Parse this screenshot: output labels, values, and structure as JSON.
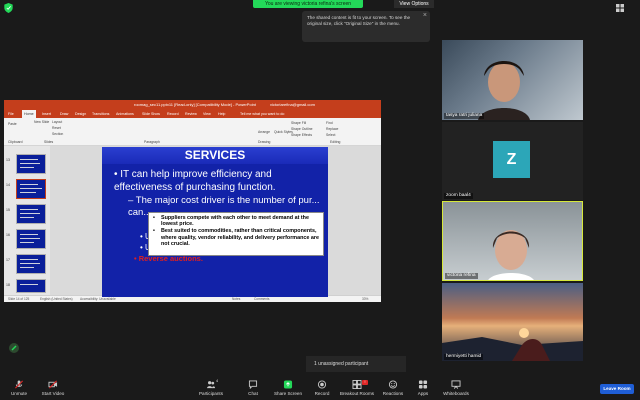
{
  "banner": {
    "sharing_text": "You are viewing victoria refina's screen",
    "view_options": "View Options"
  },
  "toast": {
    "text": "The shared content is fit to your screen. To see the original size, click \"Original Size\" in the menu."
  },
  "ppt": {
    "title": "roomag_sec11.pptx11 [Read-only] [Compatibility Mode] - PowerPoint",
    "account": "victoriarefina@gmail.com",
    "menu": [
      "File",
      "Home",
      "Insert",
      "Draw",
      "Design",
      "Transitions",
      "Animations",
      "Slide Show",
      "Record",
      "Review",
      "View",
      "Help",
      "Tell me what you want to do"
    ],
    "ribbon": {
      "paste": "Paste",
      "layout": "Layout",
      "reset": "Reset",
      "new_slide": "New Slide",
      "section": "Section",
      "slides": "Slides",
      "clipboard": "Clipboard",
      "paragraph": "Paragraph",
      "drawing": "Drawing",
      "editing": "Editing",
      "arrange": "Arrange",
      "quick_styles": "Quick Styles",
      "shape_fill": "Shape Fill",
      "shape_outline": "Shape Outline",
      "shape_effects": "Shape Effects",
      "find": "Find",
      "replace": "Replace",
      "select": "Select"
    },
    "thumb_numbers": [
      "13",
      "14",
      "15",
      "16",
      "17",
      "18"
    ],
    "status": {
      "slide": "Slide 14 of 125",
      "language": "English (United States)",
      "accessibility": "Accessibility: Unavailable",
      "notes": "Notes",
      "comments": "Comments",
      "zoom": "33%"
    }
  },
  "slide": {
    "title": "SERVICES",
    "bullet1": "IT can help improve efficiency and effectiveness of purchasing function.",
    "bullet2": "The major cost driver is the number of pur... can...",
    "bullet3": "U",
    "bullet4": "U",
    "bullet5": "Reverse auctions.",
    "popup": [
      "Suppliers compete with each other to meet demand at the lowest price.",
      "Best suited to commodities, rather than critical components, where quality, vendor reliability, and delivery performance are not crucial."
    ]
  },
  "participants": [
    {
      "name": "tasya ratri juliana"
    },
    {
      "name": "zoom baal4",
      "initial": "Z"
    },
    {
      "name": "victoria refina"
    },
    {
      "name": "hermiyetti hamid"
    }
  ],
  "unassigned": "1 unassigned participant",
  "toolbar": {
    "items": [
      "Unmute",
      "Start Video",
      "Participants",
      "Chat",
      "Share Screen",
      "Record",
      "Breakout Rooms",
      "Reactions",
      "Apps",
      "Whiteboards"
    ],
    "participants_count": "4",
    "leave": "Leave Room",
    "share_color": "#23d959",
    "leave_color": "#1f5ed6"
  }
}
